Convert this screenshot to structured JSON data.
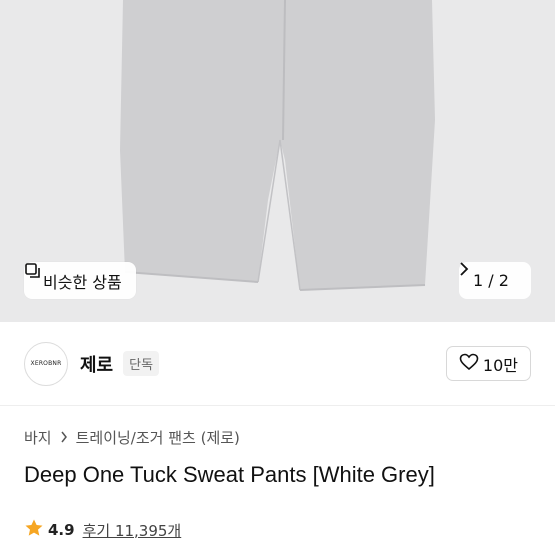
{
  "hero": {
    "similar_label": "비슷한 상품",
    "pager": "1 / 2"
  },
  "shop": {
    "logo_text": "XEROBNR",
    "name": "제로",
    "badge": "단독",
    "likes": "10만"
  },
  "breadcrumb": {
    "category": "바지",
    "subcategory": "트레이닝/조거 팬츠 (제로)"
  },
  "product": {
    "title": "Deep One Tuck Sweat Pants [White Grey]",
    "rating": "4.9",
    "reviews": "후기 11,395개"
  },
  "colors": {
    "hero_bg": "#e9e9ea",
    "pants": "#cfcfd1",
    "star": "#f6a623"
  },
  "icons": [
    "similar-icon",
    "chevron-right-icon",
    "heart-icon",
    "star-icon"
  ]
}
